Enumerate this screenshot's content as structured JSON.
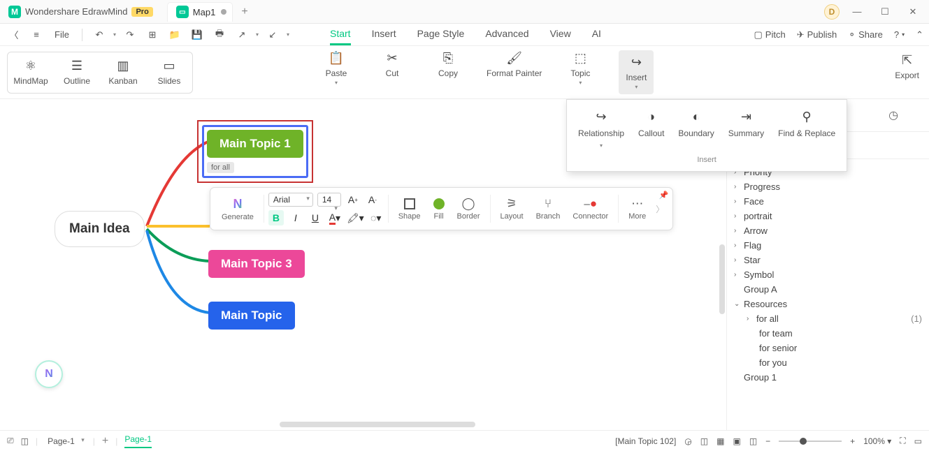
{
  "titlebar": {
    "app_name": "Wondershare EdrawMind",
    "pro_badge": "Pro",
    "doc_tab": "Map1",
    "user_initial": "D"
  },
  "menubar": {
    "file": "File",
    "tabs": [
      "Start",
      "Insert",
      "Page Style",
      "Advanced",
      "View",
      "AI"
    ],
    "active_tab": "Start",
    "right": {
      "pitch": "Pitch",
      "publish": "Publish",
      "share": "Share"
    }
  },
  "ribbon": {
    "views": {
      "mindmap": "MindMap",
      "outline": "Outline",
      "kanban": "Kanban",
      "slides": "Slides"
    },
    "actions": {
      "paste": "Paste",
      "cut": "Cut",
      "copy": "Copy",
      "format_painter": "Format Painter",
      "topic": "Topic",
      "insert": "Insert"
    },
    "export": "Export"
  },
  "insert_panel": {
    "items": {
      "relationship": "Relationship",
      "callout": "Callout",
      "boundary": "Boundary",
      "summary": "Summary",
      "find_replace": "Find & Replace"
    },
    "group_label": "Insert"
  },
  "canvas": {
    "main_idea": "Main Idea",
    "topic1": "Main Topic 1",
    "topic1_tag": "for all",
    "topic3": "Main Topic 3",
    "topic": "Main Topic"
  },
  "float_toolbar": {
    "generate": "Generate",
    "font": "Arial",
    "size": "14",
    "shape": "Shape",
    "fill": "Fill",
    "border": "Border",
    "layout": "Layout",
    "branch": "Branch",
    "connector": "Connector",
    "more": "More"
  },
  "right_panel": {
    "items": [
      "Priority",
      "Progress",
      "Face",
      "portrait",
      "Arrow",
      "Flag",
      "Star",
      "Symbol"
    ],
    "group_a": "Group A",
    "resources": "Resources",
    "resource_items": [
      {
        "label": "for all",
        "count": "(1)"
      },
      {
        "label": "for team"
      },
      {
        "label": "for senior"
      },
      {
        "label": "for you"
      }
    ],
    "group_1": "Group 1"
  },
  "statusbar": {
    "page_selector": "Page-1",
    "page_tab": "Page-1",
    "selection": "[Main Topic 102]",
    "zoom": "100%"
  }
}
